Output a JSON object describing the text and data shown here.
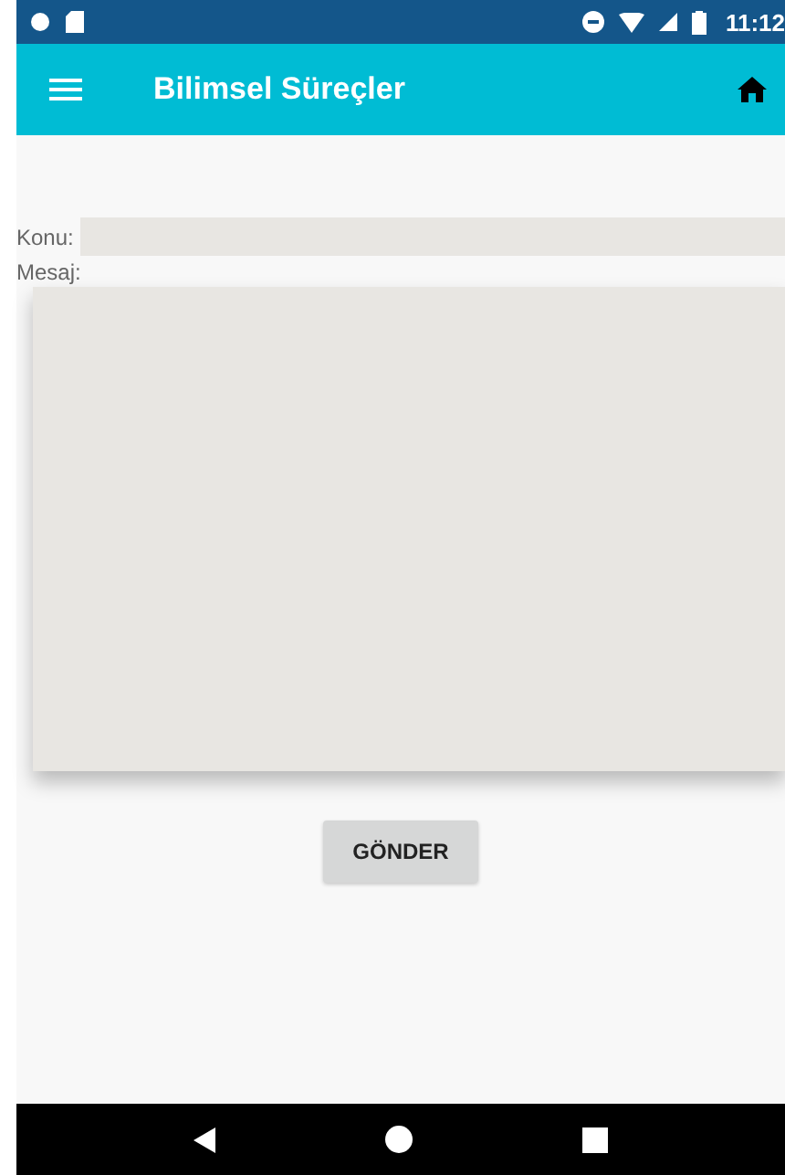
{
  "status_bar": {
    "time": "11:12"
  },
  "app_bar": {
    "title": "Bilimsel Süreçler"
  },
  "form": {
    "subject_label": "Konu:",
    "message_label": "Mesaj:",
    "submit": "GÖNDER"
  }
}
